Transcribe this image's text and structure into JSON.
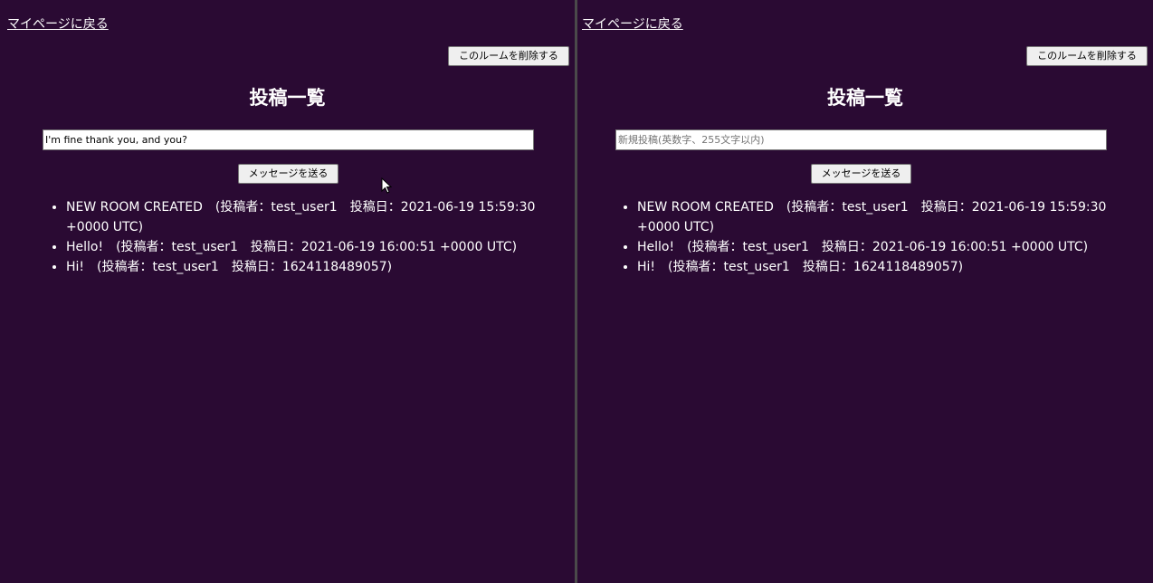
{
  "panes": [
    {
      "back_link": "マイページに戻る",
      "delete_button": "このルームを削除する",
      "title": "投稿一覧",
      "input_value": "I'm fine thank you, and you?",
      "input_placeholder": "新規投稿(英数字、255文字以内)",
      "send_button": "メッセージを送る",
      "posts": [
        "NEW ROOM CREATED　(投稿者：test_user1　投稿日：2021-06-19 15:59:30 +0000 UTC)",
        "Hello!　(投稿者：test_user1　投稿日：2021-06-19 16:00:51 +0000 UTC)",
        "Hi!　(投稿者：test_user1　投稿日：1624118489057)"
      ]
    },
    {
      "back_link": "マイページに戻る",
      "delete_button": "このルームを削除する",
      "title": "投稿一覧",
      "input_value": "",
      "input_placeholder": "新規投稿(英数字、255文字以内)",
      "send_button": "メッセージを送る",
      "posts": [
        "NEW ROOM CREATED　(投稿者：test_user1　投稿日：2021-06-19 15:59:30 +0000 UTC)",
        "Hello!　(投稿者：test_user1　投稿日：2021-06-19 16:00:51 +0000 UTC)",
        "Hi!　(投稿者：test_user1　投稿日：1624118489057)"
      ]
    }
  ],
  "icons": {
    "mouse_cursor": "arrow-cursor-icon"
  },
  "colors": {
    "background": "#2a0a33",
    "text": "#ffffff",
    "divider": "#4a4a4a"
  }
}
